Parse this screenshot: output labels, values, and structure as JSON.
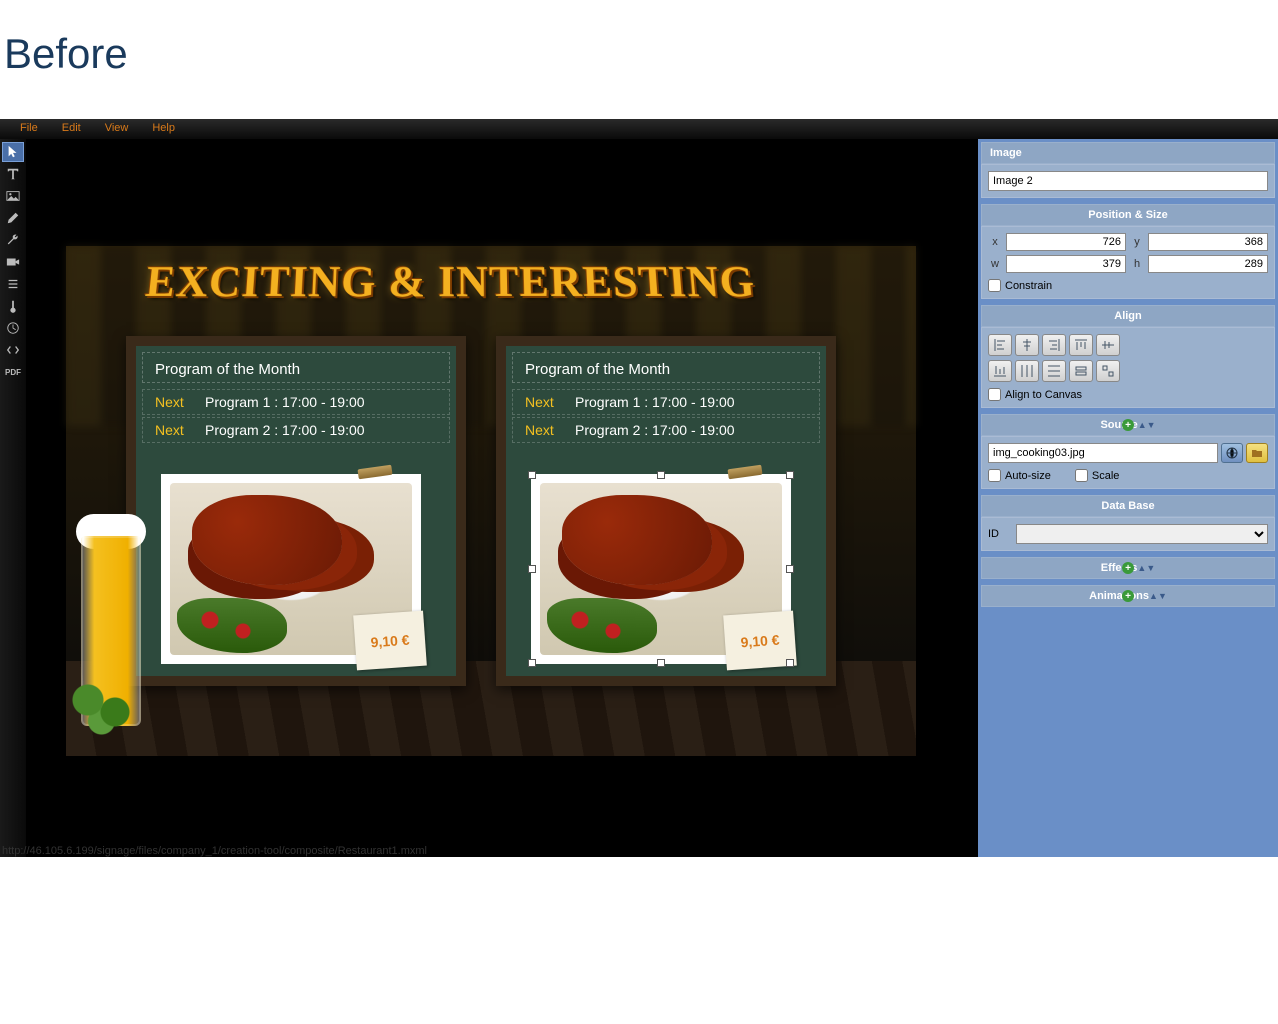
{
  "page_title": "Before",
  "menu": {
    "file": "File",
    "edit": "Edit",
    "view": "View",
    "help": "Help"
  },
  "canvas": {
    "headline": "EXCITING & INTERESTING",
    "boards": [
      {
        "title": "Program of the Month",
        "rows": [
          {
            "tag": "Next",
            "text": "Program 1 : 17:00 - 19:00"
          },
          {
            "tag": "Next",
            "text": "Program 2 : 17:00 - 19:00"
          }
        ],
        "price": "9,10 €"
      },
      {
        "title": "Program of the Month",
        "rows": [
          {
            "tag": "Next",
            "text": "Program 1 : 17:00 - 19:00"
          },
          {
            "tag": "Next",
            "text": "Program 2 : 17:00 - 19:00"
          }
        ],
        "price": "9,10 €"
      }
    ]
  },
  "props": {
    "image_section": "Image",
    "image_name": "Image 2",
    "pos_section": "Position & Size",
    "x_label": "x",
    "x_value": "726",
    "y_label": "y",
    "y_value": "368",
    "w_label": "w",
    "w_value": "379",
    "h_label": "h",
    "h_value": "289",
    "constrain": "Constrain",
    "align_section": "Align",
    "align_canvas": "Align to Canvas",
    "source_section": "Source",
    "source_value": "img_cooking03.jpg",
    "auto_size": "Auto-size",
    "scale": "Scale",
    "database_section": "Data Base",
    "id_label": "ID",
    "effects_section": "Effects",
    "animations_section": "Animations"
  },
  "status_bar": "http://46.105.6.199/signage/files/company_1/creation-tool/composite/Restaurant1.mxml"
}
